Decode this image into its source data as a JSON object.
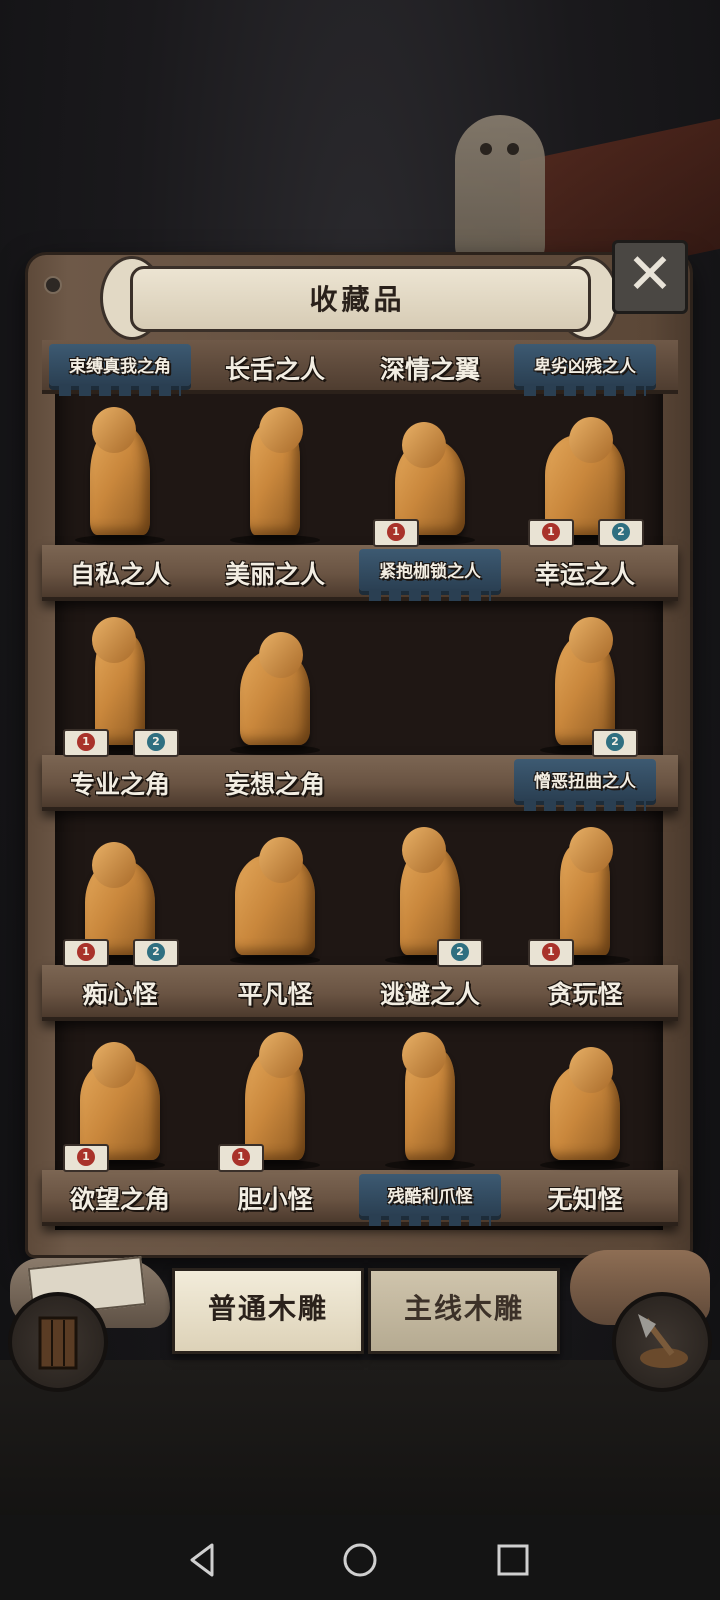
{
  "header": {
    "title": "收藏品",
    "close_icon": "close-x-icon"
  },
  "shelves": [
    [
      {
        "name": "束缚真我之角",
        "style": "special",
        "size": "small",
        "badges": []
      },
      {
        "name": "长舌之人",
        "style": "plain",
        "size": "big",
        "badges": []
      },
      {
        "name": "深情之翼",
        "style": "plain",
        "size": "big",
        "badges": []
      },
      {
        "name": "卑劣凶残之人",
        "style": "special",
        "size": "small",
        "badges": []
      }
    ],
    [
      {
        "name": "自私之人",
        "style": "plain",
        "size": "big",
        "badges": []
      },
      {
        "name": "美丽之人",
        "style": "plain",
        "size": "big",
        "badges": []
      },
      {
        "name": "紧抱枷锁之人",
        "style": "special",
        "size": "small",
        "badges": [
          "1"
        ]
      },
      {
        "name": "幸运之人",
        "style": "plain",
        "size": "big",
        "badges": [
          "1",
          "2"
        ]
      }
    ],
    [
      {
        "name": "专业之角",
        "style": "plain",
        "size": "big",
        "badges": [
          "1",
          "2"
        ]
      },
      {
        "name": "妄想之角",
        "style": "plain",
        "size": "big",
        "badges": []
      },
      {
        "name": "",
        "style": "empty",
        "size": "big",
        "badges": []
      },
      {
        "name": "憎恶扭曲之人",
        "style": "special",
        "size": "small",
        "badges": [
          "2"
        ]
      }
    ],
    [
      {
        "name": "痴心怪",
        "style": "plain",
        "size": "big",
        "badges": [
          "1",
          "2"
        ]
      },
      {
        "name": "平凡怪",
        "style": "plain",
        "size": "big",
        "badges": []
      },
      {
        "name": "逃避之人",
        "style": "plain",
        "size": "big",
        "badges": [
          "2"
        ]
      },
      {
        "name": "贪玩怪",
        "style": "plain",
        "size": "big",
        "badges": [
          "1"
        ]
      }
    ],
    [
      {
        "name": "欲望之角",
        "style": "plain",
        "size": "big",
        "badges": [
          "1"
        ]
      },
      {
        "name": "胆小怪",
        "style": "plain",
        "size": "big",
        "badges": [
          "1"
        ]
      },
      {
        "name": "残酷利爪怪",
        "style": "special",
        "size": "small",
        "badges": []
      },
      {
        "name": "无知怪",
        "style": "plain",
        "size": "big",
        "badges": []
      }
    ]
  ],
  "tabs": {
    "active": "普通木雕",
    "inactive": "主线木雕"
  },
  "colors": {
    "gem_1": "#a9322a",
    "gem_2": "#2f6f80",
    "wood": "#6a5443",
    "figure": "#c9873c"
  },
  "navbar": {
    "back_icon": "back-triangle-icon",
    "home_icon": "home-circle-icon",
    "recents_icon": "recents-square-icon"
  }
}
